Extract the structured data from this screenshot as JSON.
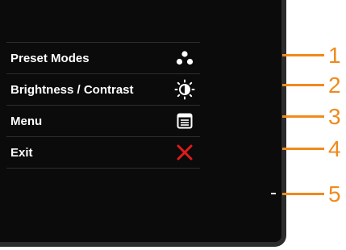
{
  "osd": {
    "items": [
      {
        "label": "Preset Modes",
        "icon": "preset-modes-dots-icon"
      },
      {
        "label": "Brightness / Contrast",
        "icon": "brightness-contrast-icon"
      },
      {
        "label": "Menu",
        "icon": "menu-icon"
      },
      {
        "label": "Exit",
        "icon": "exit-x-icon"
      }
    ]
  },
  "callouts": [
    "1",
    "2",
    "3",
    "4",
    "5"
  ],
  "colors": {
    "callout": "#f08a1c",
    "exit": "#e01b1b",
    "text": "#ffffff",
    "screen": "#0b0b0b"
  }
}
